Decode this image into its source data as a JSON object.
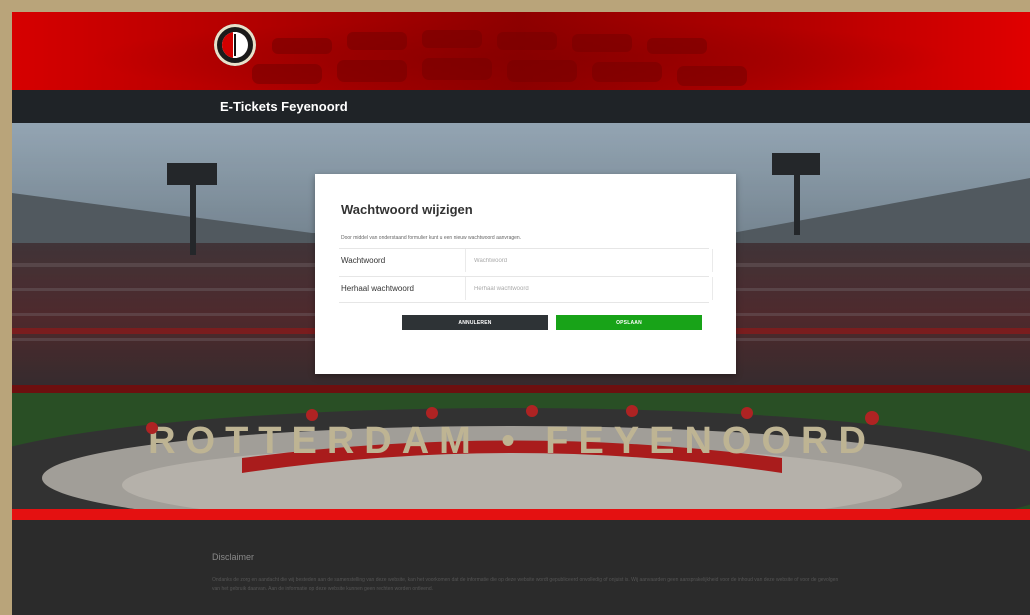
{
  "app": {
    "title": "E-Tickets Feyenoord"
  },
  "dialog": {
    "title": "Wachtwoord wijzigen",
    "description": "Door middel van onderstaand formulier kunt u een nieuw wachtwoord aanvragen.",
    "fields": [
      {
        "label": "Wachtwoord",
        "placeholder": "Wachtwoord",
        "value": ""
      },
      {
        "label": "Herhaal wachtwoord",
        "placeholder": "Herhaal wachtwoord",
        "value": ""
      }
    ],
    "cancel_label": "ANNULEREN",
    "save_label": "OPSLAAN"
  },
  "hero": {
    "banner_text": "ROTTERDAM • FEYENOORD"
  },
  "footer": {
    "disclaimer_title": "Disclaimer",
    "disclaimer_text": "Ondanks de zorg en aandacht die wij besteden aan de samenstelling van deze website, kan het voorkomen dat de informatie die op deze website wordt gepubliceerd onvolledig of onjuist is. Wij aanvaarden geen aansprakelijkheid voor de inhoud van deze website of voor de gevolgen van het gebruik daarvan. Aan de informatie op deze website kunnen geen rechten worden ontleend."
  },
  "colors": {
    "brand_red": "#e41111",
    "save_green": "#18a318",
    "cancel_dark": "#2e3336",
    "titlebar": "#1f2327"
  }
}
